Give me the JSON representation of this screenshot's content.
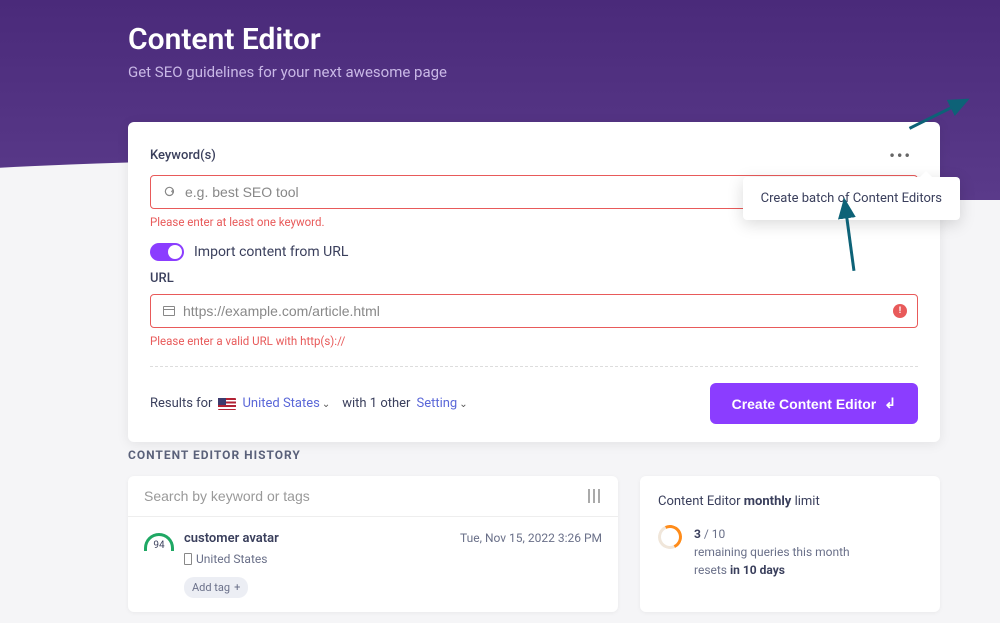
{
  "hero": {
    "title": "Content Editor",
    "subtitle": "Get SEO guidelines for your next awesome page"
  },
  "card": {
    "keywords_label": "Keyword(s)",
    "keywords_placeholder": "e.g. best SEO tool",
    "keywords_error": "Please enter at least one keyword.",
    "import_toggle_label": "Import content from URL",
    "url_label": "URL",
    "url_placeholder": "https://example.com/article.html",
    "url_error": "Please enter a valid URL with http(s)://",
    "results_for": "Results for",
    "country": "United States",
    "with_other": "with 1 other",
    "setting": "Setting",
    "create_button": "Create Content Editor",
    "tooltip": "Create batch of Content Editors"
  },
  "history": {
    "section_title": "CONTENT EDITOR HISTORY",
    "search_placeholder": "Search by keyword or tags",
    "item": {
      "score": "94",
      "title": "customer avatar",
      "location": "United States",
      "date": "Tue, Nov 15, 2022 3:26 PM",
      "add_tag": "Add tag"
    },
    "limit": {
      "title_prefix": "Content Editor ",
      "title_bold": "monthly",
      "title_suffix": " limit",
      "used": "3",
      "total": "10",
      "line1": "remaining queries this month",
      "line2_prefix": "resets ",
      "line2_bold": "in 10 days"
    }
  }
}
